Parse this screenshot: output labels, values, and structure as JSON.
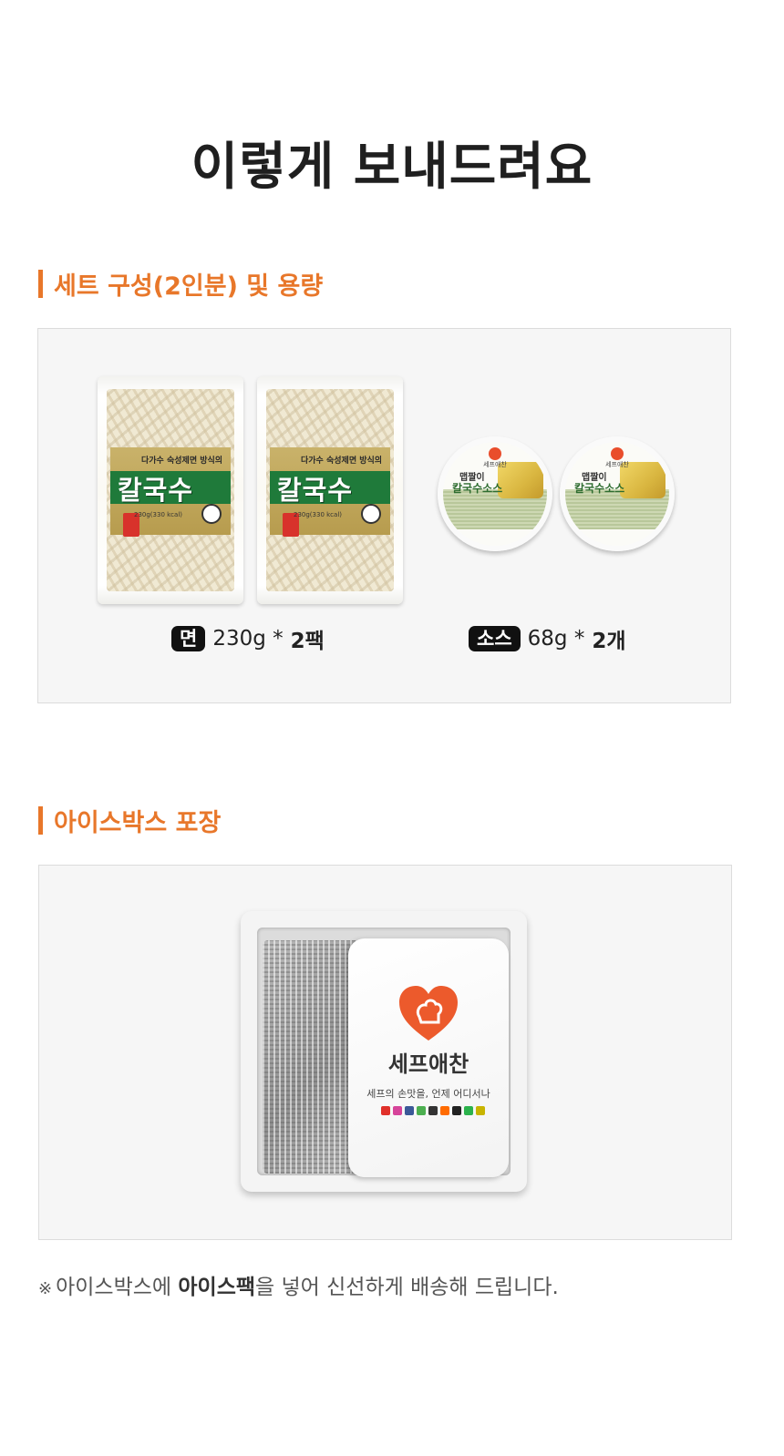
{
  "page": {
    "title": "이렇게 보내드려요"
  },
  "set_section": {
    "heading": "세트 구성(2인분) 및 용량",
    "accent_color": "#e8772a",
    "noodle_pack": {
      "top_text": "다가수 숙성제면 방식의",
      "name": "칼국수",
      "weight_text": "230g(330 kcal)"
    },
    "sauce_cup": {
      "brand": "세프애찬",
      "line1": "맵짤이",
      "line2": "칼국수소스"
    },
    "items": [
      {
        "badge": "면",
        "spec": "230g *",
        "count": "2팩"
      },
      {
        "badge": "소스",
        "spec": "68g *",
        "count": "2개"
      }
    ]
  },
  "icebox_section": {
    "heading": "아이스박스 포장",
    "icepack": {
      "brand_name": "세프애찬",
      "slogan": "세프의 손맛을, 언제 어디서나",
      "social_colors": [
        "#e0302a",
        "#d6449a",
        "#3b5998",
        "#4caf50",
        "#333333",
        "#ff6b00",
        "#222222",
        "#2bb24c",
        "#c8b400"
      ]
    }
  },
  "footnote": {
    "mark": "※",
    "before": "아이스박스에 ",
    "emphasis": "아이스팩",
    "after": "을 넣어 신선하게 배송해 드립니다."
  }
}
